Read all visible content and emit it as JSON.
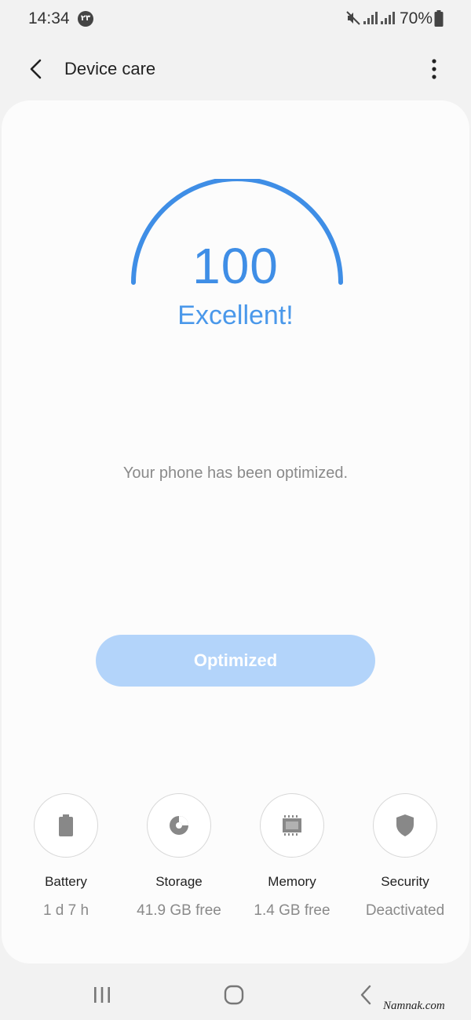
{
  "status_bar": {
    "time": "14:34",
    "notification_badge": "۲۳",
    "battery_percent": "70%"
  },
  "app_bar": {
    "title": "Device care",
    "back_icon": "back-arrow-icon",
    "more_icon": "more-vert-icon"
  },
  "score": {
    "value": "100",
    "status": "Excellent!",
    "gauge_fraction": 1.0,
    "message": "Your phone has been optimized."
  },
  "optimize_button": {
    "label": "Optimized"
  },
  "features": [
    {
      "label": "Battery",
      "value": "1 d 7 h",
      "icon": "battery-icon"
    },
    {
      "label": "Storage",
      "value": "41.9 GB free",
      "icon": "storage-icon"
    },
    {
      "label": "Memory",
      "value": "1.4 GB free",
      "icon": "memory-icon"
    },
    {
      "label": "Security",
      "value": "Deactivated",
      "icon": "shield-icon"
    }
  ],
  "colors": {
    "accent": "#3f8ee6",
    "button_disabled": "#b3d4fa",
    "background": "#f2f2f2",
    "card": "#fcfcfc",
    "muted_text": "#8a8a8a"
  },
  "watermark": "Namnak.com"
}
